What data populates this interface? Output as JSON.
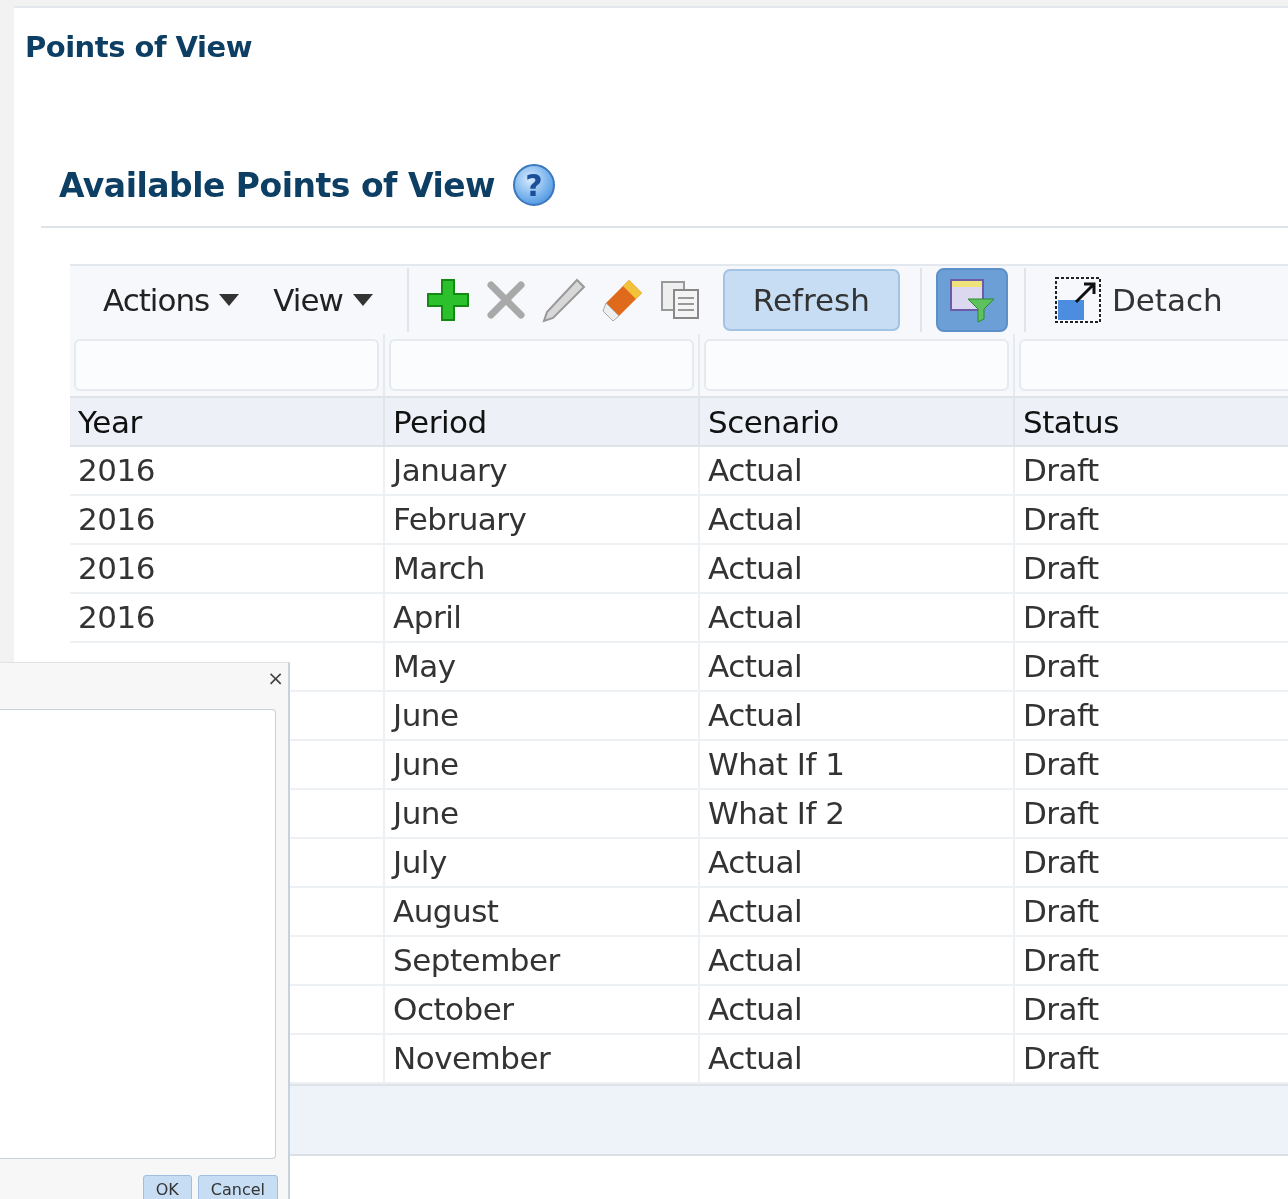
{
  "page_title": "Points of View",
  "section": {
    "title": "Available Points of View",
    "help": "?"
  },
  "toolbar": {
    "menus": [
      "Actions",
      "View"
    ],
    "refresh": "Refresh",
    "filter_toggle": {
      "selected": true
    },
    "detach": "Detach"
  },
  "table": {
    "columns": [
      "Year",
      "Period",
      "Scenario",
      "Status"
    ],
    "rows": [
      {
        "year": "2016",
        "period": "January",
        "scenario": "Actual",
        "status": "Draft"
      },
      {
        "year": "2016",
        "period": "February",
        "scenario": "Actual",
        "status": "Draft"
      },
      {
        "year": "2016",
        "period": "March",
        "scenario": "Actual",
        "status": "Draft"
      },
      {
        "year": "2016",
        "period": "April",
        "scenario": "Actual",
        "status": "Draft"
      },
      {
        "period": "May",
        "scenario": "Actual",
        "status": "Draft"
      },
      {
        "period": "June",
        "scenario": "Actual",
        "status": "Draft"
      },
      {
        "period": "June",
        "scenario": "What If 1",
        "status": "Draft"
      },
      {
        "period": "June",
        "scenario": "What If 2",
        "status": "Draft"
      },
      {
        "period": "July",
        "scenario": "Actual",
        "status": "Draft"
      },
      {
        "period": "August",
        "scenario": "Actual",
        "status": "Draft"
      },
      {
        "period": "September",
        "scenario": "Actual",
        "status": "Draft"
      },
      {
        "period": "October",
        "scenario": "Actual",
        "status": "Draft"
      },
      {
        "period": "November",
        "scenario": "Actual",
        "status": "Draft"
      }
    ]
  },
  "dialog": {
    "close": "×",
    "buttons": [
      "OK",
      "Cancel"
    ]
  }
}
